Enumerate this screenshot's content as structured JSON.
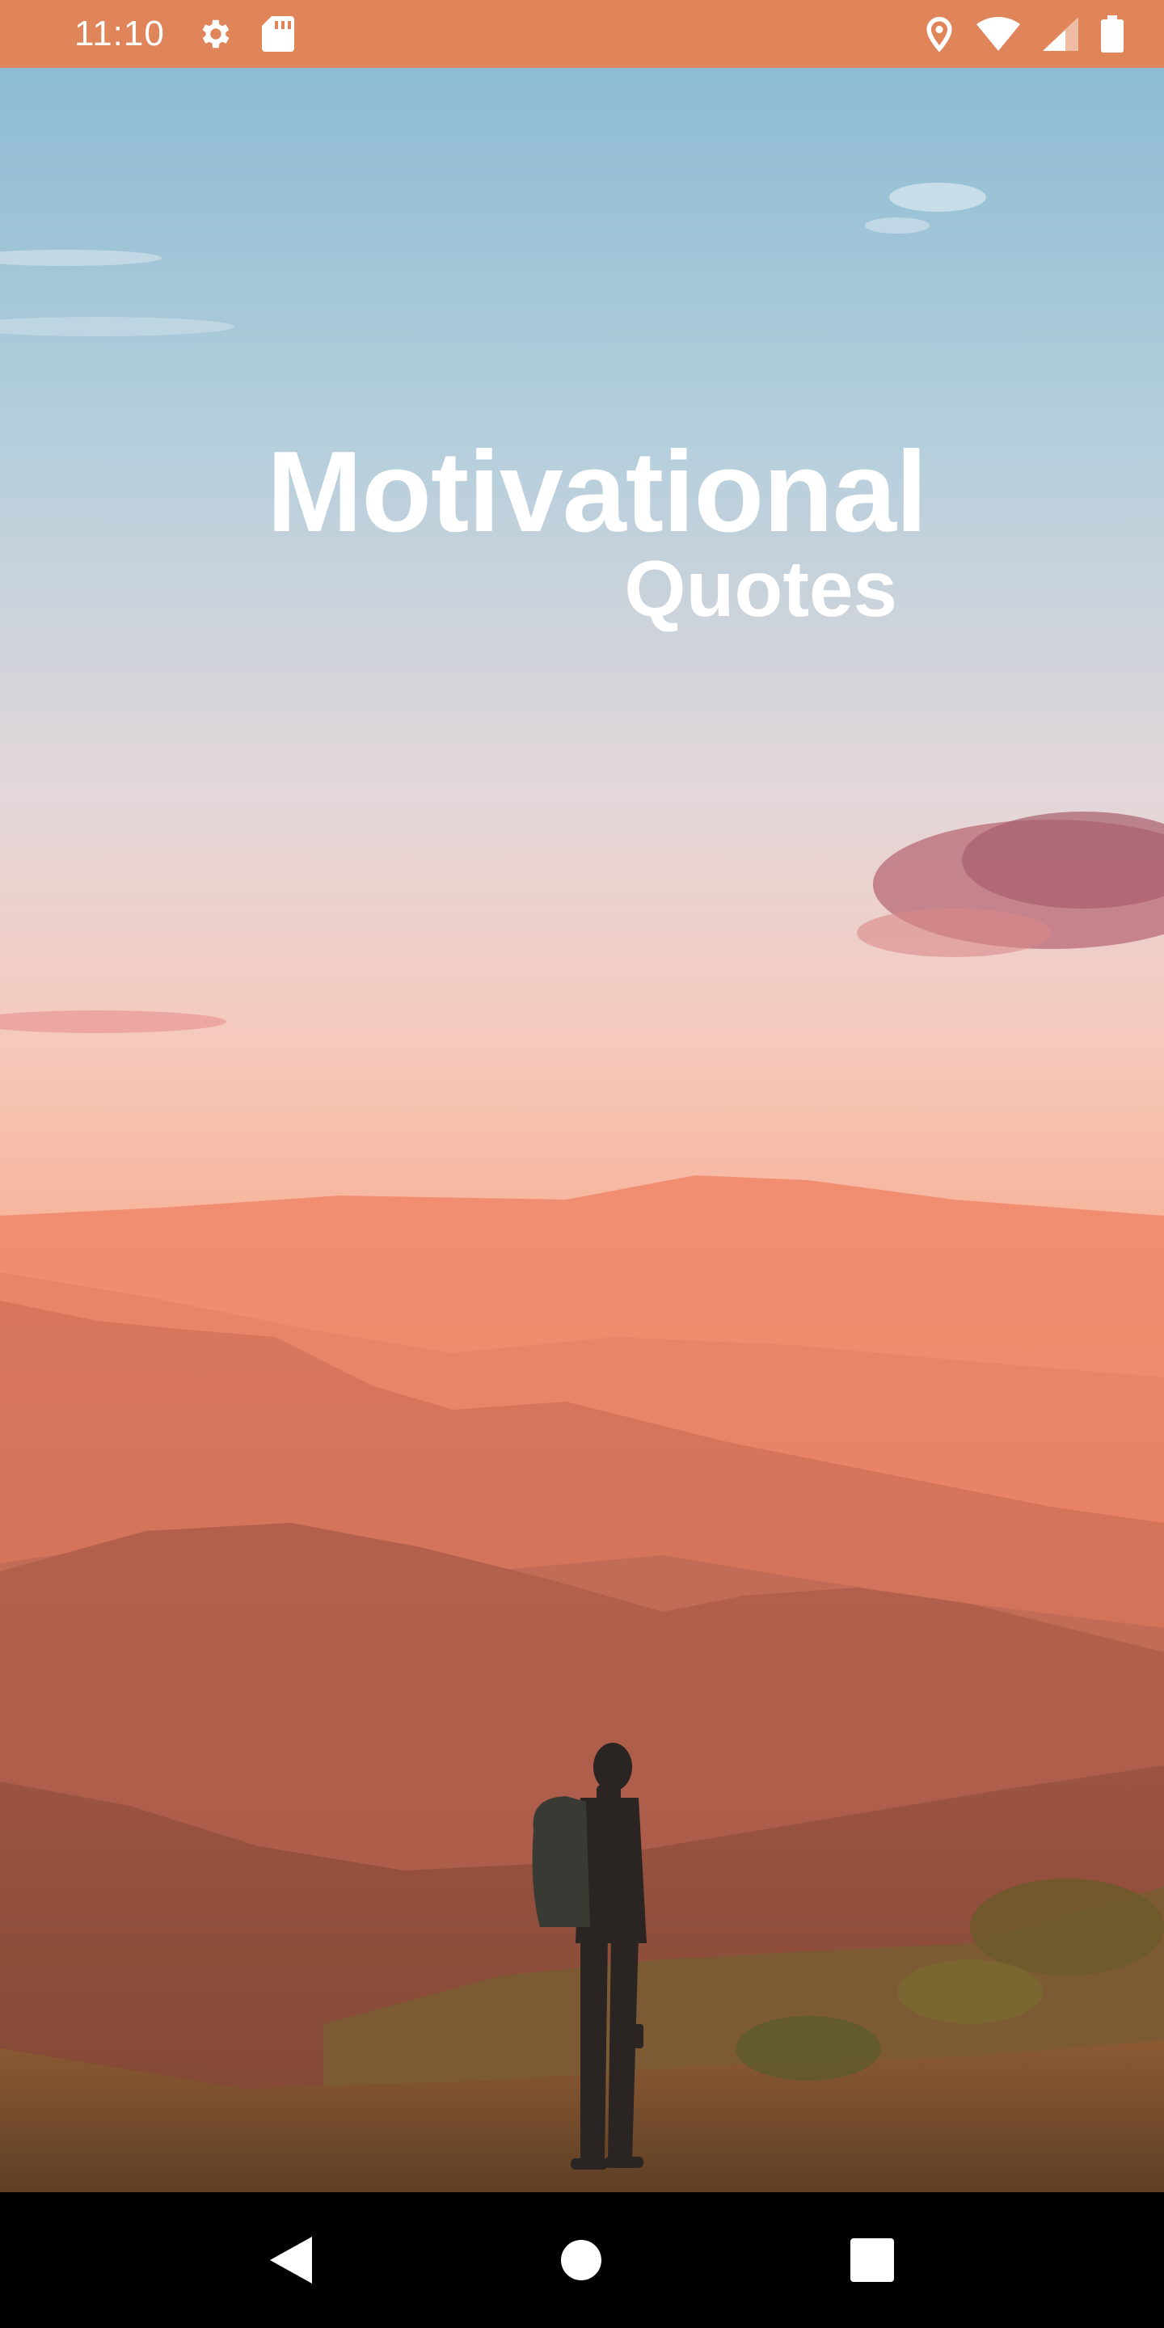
{
  "status_bar": {
    "time": "11:10",
    "background": "#e0845a",
    "left_icons": [
      "gear-icon",
      "sd-card-icon"
    ],
    "right_icons": [
      "location-icon",
      "wifi-icon",
      "signal-icon",
      "battery-icon"
    ]
  },
  "splash": {
    "title": "Motivational",
    "subtitle": "Quotes"
  },
  "nav_bar": {
    "buttons": [
      "back-icon",
      "home-icon",
      "recents-icon"
    ]
  }
}
